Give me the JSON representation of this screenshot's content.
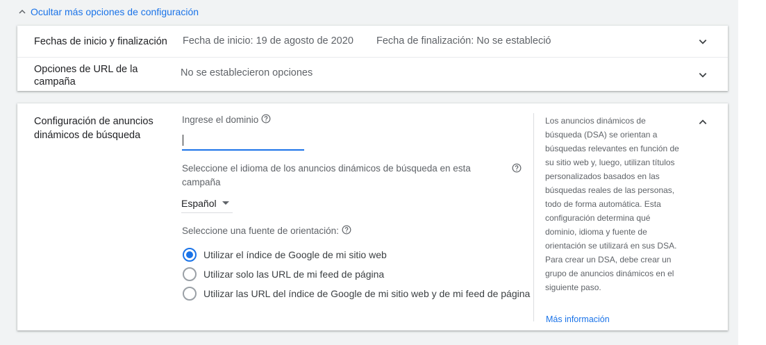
{
  "toggle": {
    "label": "Ocultar más opciones de configuración",
    "icon": "chevron-up-icon"
  },
  "dates_row": {
    "label": "Fechas de inicio y finalización",
    "start": "Fecha de inicio: 19 de agosto de 2020",
    "end": "Fecha de finalización: No se estableció",
    "icon": "chevron-down-icon"
  },
  "url_row": {
    "label": "Opciones de URL de la campaña",
    "value": "No se establecieron opciones",
    "icon": "chevron-down-icon"
  },
  "dsa": {
    "label": "Configuración de anuncios dinámicos de búsqueda",
    "domain_label": "Ingrese el dominio",
    "domain_value": "",
    "language_label": "Seleccione el idioma de los anuncios dinámicos de búsqueda en esta campaña",
    "language_value": "Español",
    "source_label": "Seleccione una fuente de orientación:",
    "options": [
      {
        "label": "Utilizar el índice de Google de mi sitio web",
        "selected": true
      },
      {
        "label": "Utilizar solo las URL de mi feed de página",
        "selected": false
      },
      {
        "label": "Utilizar las URL del índice de Google de mi sitio web y de mi feed de página",
        "selected": false
      }
    ],
    "help_text": "Los anuncios dinámicos de búsqueda (DSA) se orientan a búsquedas relevantes en función de su sitio web y, luego, utilizan títulos personalizados basados en las búsquedas reales de las personas, todo de forma automática. Esta configuración determina qué dominio, idioma y fuente de orientación se utilizará en sus DSA. Para crear un DSA, debe crear un grupo de anuncios dinámicos en el siguiente paso.",
    "learn_more": "Más información",
    "icon": "chevron-up-icon"
  },
  "colors": {
    "accent": "#1a73e8",
    "text": "#202124",
    "muted": "#5f6368",
    "background": "#f1f3f4"
  }
}
